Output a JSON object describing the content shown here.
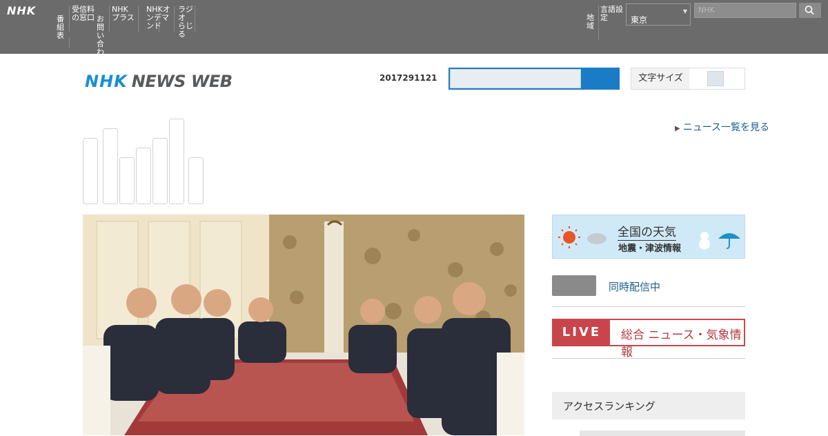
{
  "global_nav": {
    "logo": "NHK",
    "items": [
      "番組表",
      "受信料の窓口",
      "お問い合わせ",
      "NHKプラス",
      "NHKオンデマンド",
      "ラジオ らじる"
    ],
    "right_items": [
      "地域",
      "言語設定"
    ],
    "region_value": "東京",
    "search_placeholder": "NHK"
  },
  "header": {
    "logo_nhk": "NHK",
    "logo_newsweb": "NEWS WEB",
    "date": "2017291121",
    "settings_label": "文字サイズ"
  },
  "links": {
    "news_list": "ニュース一覧を見る"
  },
  "sidebar": {
    "weather_title": "全国の天気",
    "weather_sub": "地震・津波情報",
    "nhkplus_label": "同時配信中",
    "live_tag": "LIVE",
    "live_text": "総合 ニュース・気象情報",
    "ranking_title": "アクセスランキング"
  },
  "colors": {
    "topbar": "#6b6b6b",
    "brand_blue": "#1a8fd4",
    "accent_blue": "#1a7cc7",
    "live_red": "#c9454c",
    "link": "#1a5d8f"
  }
}
